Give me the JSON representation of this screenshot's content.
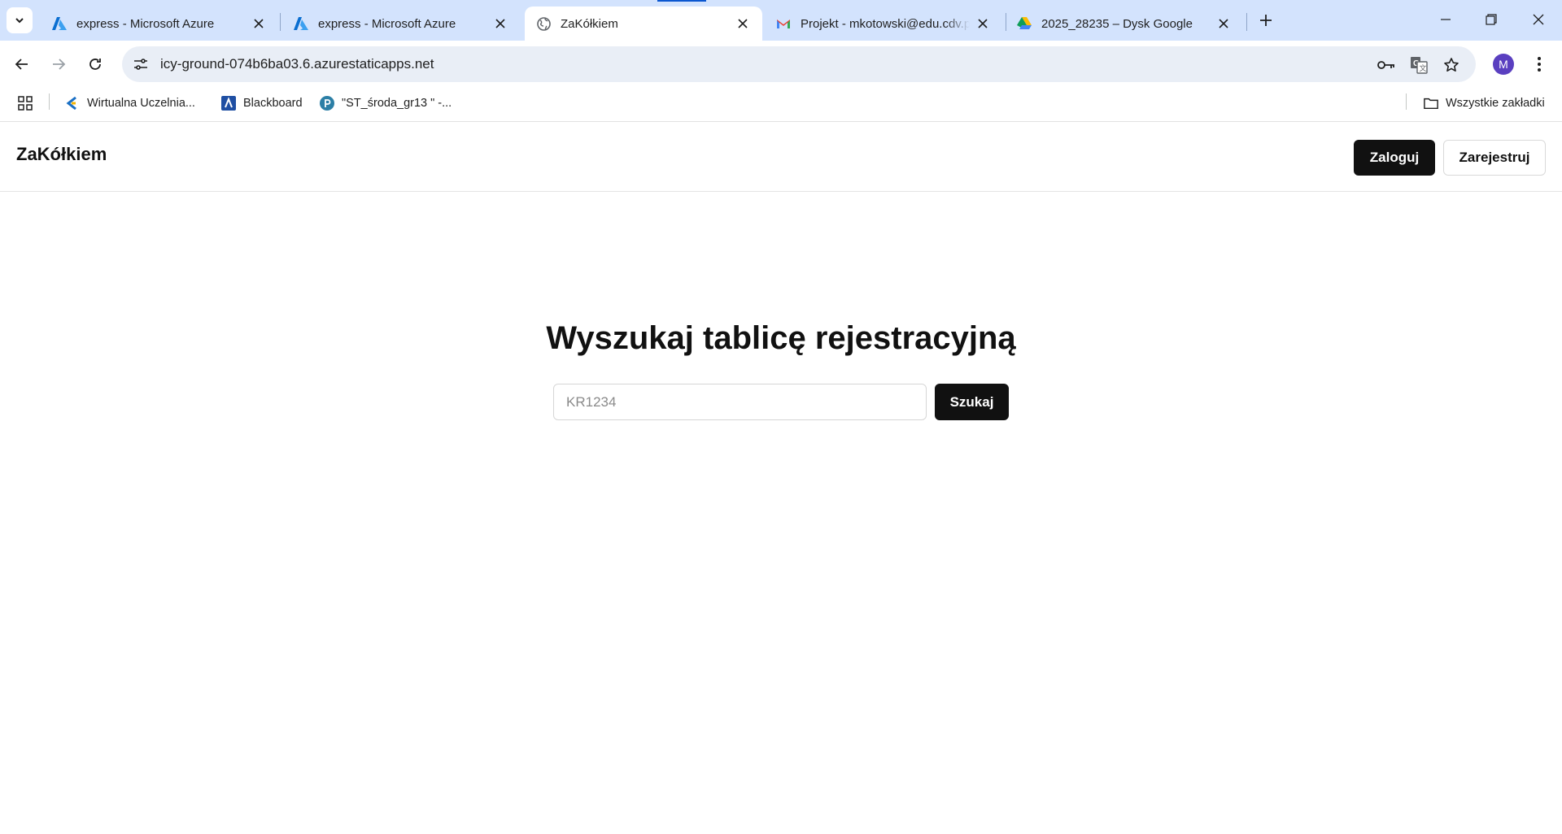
{
  "browser": {
    "tabs": [
      {
        "title": "express - Microsoft Azure",
        "icon": "azure-icon",
        "active": false
      },
      {
        "title": "express - Microsoft Azure",
        "icon": "azure-icon",
        "active": false
      },
      {
        "title": "ZaKółkiem",
        "icon": "globe-icon",
        "active": true
      },
      {
        "title": "Projekt - mkotowski@edu.cdv.pl",
        "icon": "gmail-icon",
        "active": false
      },
      {
        "title": "2025_28235 – Dysk Google",
        "icon": "google-drive-icon",
        "active": false
      }
    ],
    "url": "icy-ground-074b6ba03.6.azurestaticapps.net",
    "profile_initial": "M",
    "bookmarks": [
      {
        "label": "Wirtualna Uczelnia...",
        "icon": "wirtualna-uczelnia-icon"
      },
      {
        "label": "Blackboard",
        "icon": "blackboard-icon"
      },
      {
        "label": "\"ST_środa_gr13 \" -...",
        "icon": "padlet-icon"
      }
    ],
    "all_bookmarks_label": "Wszystkie zakładki",
    "colors": {
      "tabstrip": "#d3e3fd",
      "omnibox": "#e9eef6",
      "accent": "#0b57d0"
    }
  },
  "page": {
    "brand": "ZaKółkiem",
    "login_label": "Zaloguj",
    "register_label": "Zarejestruj",
    "hero_title": "Wyszukaj tablicę rejestracyjną",
    "search": {
      "placeholder": "KR1234",
      "value": "",
      "button_label": "Szukaj"
    },
    "colors": {
      "primary_button": "#111111",
      "background": "#ffffff"
    }
  }
}
